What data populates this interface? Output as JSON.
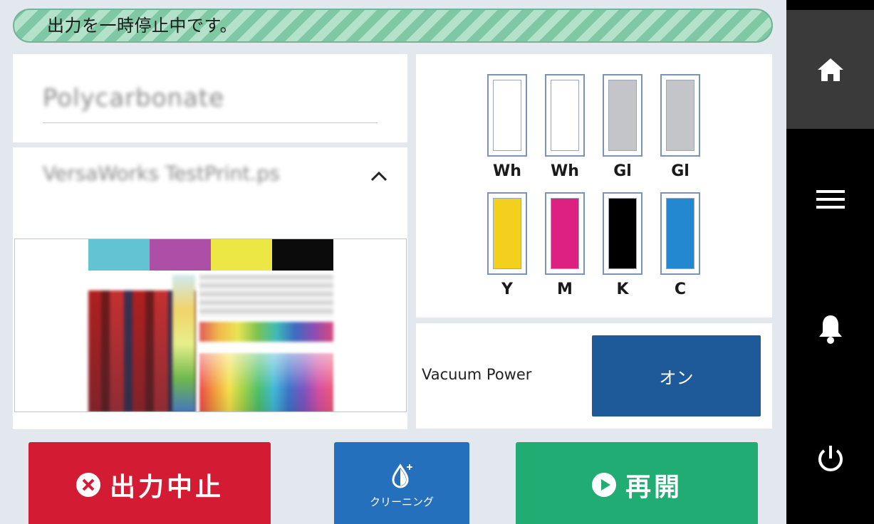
{
  "status": {
    "message": "出力を一時停止中です。"
  },
  "media": {
    "name": "Polycarbonate"
  },
  "job": {
    "name": "VersaWorks TestPrint.ps"
  },
  "inks": [
    {
      "label": "Wh",
      "color": "#ffffff"
    },
    {
      "label": "Wh",
      "color": "#ffffff"
    },
    {
      "label": "Gl",
      "color": "#c4c5c9"
    },
    {
      "label": "Gl",
      "color": "#c4c5c9"
    },
    {
      "label": "Y",
      "color": "#f3d01e"
    },
    {
      "label": "M",
      "color": "#dc2180"
    },
    {
      "label": "K",
      "color": "#000000"
    },
    {
      "label": "C",
      "color": "#2388cf"
    }
  ],
  "vacuum": {
    "label": "Vacuum Power",
    "value": "オン"
  },
  "actions": {
    "stop_label": "出力中止",
    "cleaning_label": "クリーニング",
    "resume_label": "再開"
  },
  "colors": {
    "status_stripe": "#7ec8a3",
    "stop": "#d41b34",
    "cleaning": "#2470bd",
    "resume": "#20ac72",
    "vacuum_button": "#1e5a9a"
  },
  "sidebar": {
    "items": [
      {
        "icon": "home-icon",
        "active": true
      },
      {
        "icon": "menu-icon",
        "active": false
      },
      {
        "icon": "bell-icon",
        "active": false
      },
      {
        "icon": "power-icon",
        "active": false
      }
    ]
  }
}
